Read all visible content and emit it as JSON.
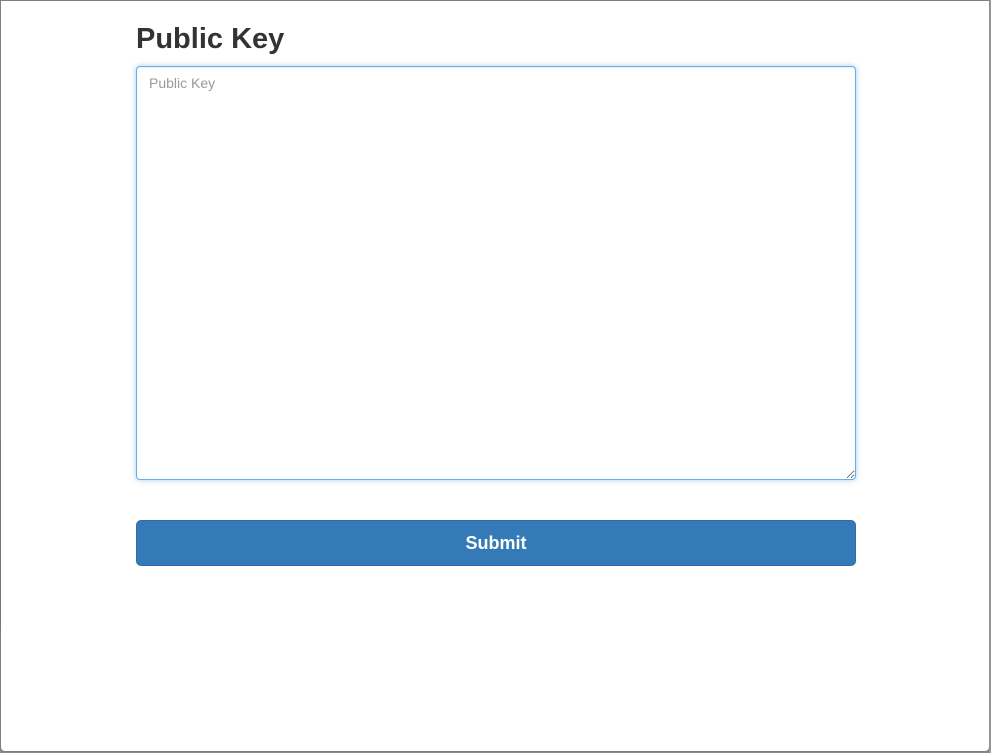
{
  "form": {
    "title": "Public Key",
    "public_key": {
      "value": "",
      "placeholder": "Public Key"
    },
    "submit_label": "Submit"
  },
  "colors": {
    "primary": "#337ab7",
    "title_text": "#333333",
    "focus_border": "#66afe9"
  }
}
